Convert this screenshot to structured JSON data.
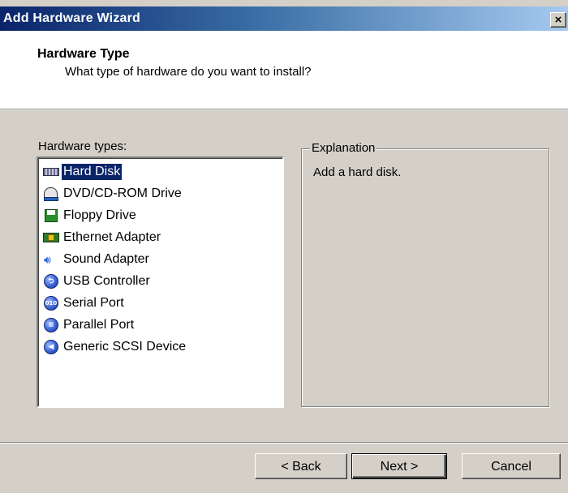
{
  "window": {
    "title": "Add Hardware Wizard",
    "close_glyph": "×"
  },
  "header": {
    "title": "Hardware Type",
    "subtitle": "What type of hardware do you want to install?"
  },
  "hardware_list": {
    "label": "Hardware types:",
    "selected_index": 0,
    "items": [
      {
        "label": "Hard Disk",
        "icon": "hard-disk-icon"
      },
      {
        "label": "DVD/CD-ROM Drive",
        "icon": "dvd-drive-icon"
      },
      {
        "label": "Floppy Drive",
        "icon": "floppy-drive-icon"
      },
      {
        "label": "Ethernet Adapter",
        "icon": "ethernet-adapter-icon"
      },
      {
        "label": "Sound Adapter",
        "icon": "speaker-icon"
      },
      {
        "label": "USB Controller",
        "icon": "usb-icon"
      },
      {
        "label": "Serial Port",
        "icon": "serial-port-icon"
      },
      {
        "label": "Parallel Port",
        "icon": "parallel-port-icon"
      },
      {
        "label": "Generic SCSI Device",
        "icon": "scsi-icon"
      }
    ]
  },
  "explanation": {
    "legend": "Explanation",
    "text": "Add a hard disk."
  },
  "buttons": {
    "back": "< Back",
    "next": "Next >",
    "cancel": "Cancel"
  },
  "colors": {
    "selection_bg": "#0a246a",
    "face": "#d4d0c8"
  }
}
